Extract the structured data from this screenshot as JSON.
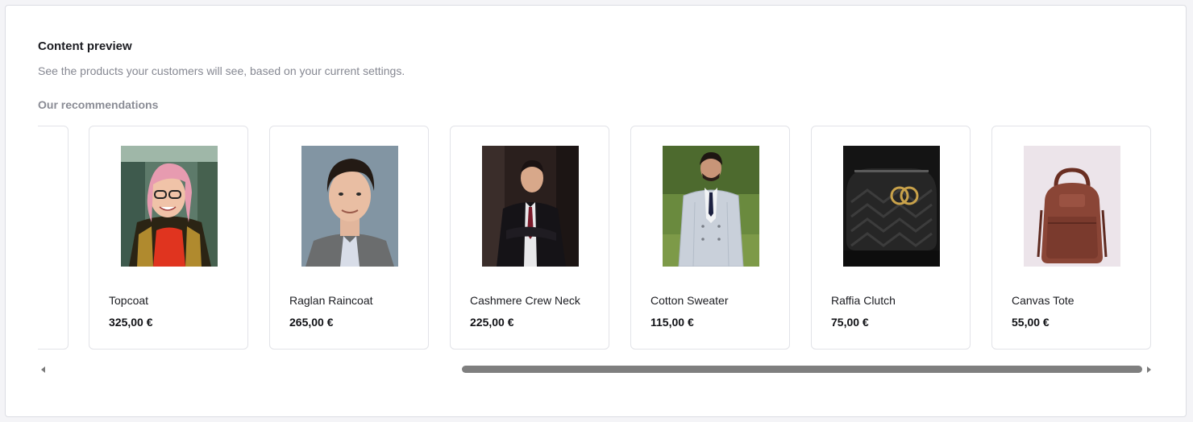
{
  "header": {
    "title": "Content preview",
    "subtitle": "See the products your customers will see, based on your current settings."
  },
  "recommendations": {
    "label": "Our recommendations",
    "products": [
      {
        "name": "Topcoat",
        "price": "325,00 €"
      },
      {
        "name": "Raglan Raincoat",
        "price": "265,00 €"
      },
      {
        "name": "Cashmere Crew Neck",
        "price": "225,00 €"
      },
      {
        "name": "Cotton Sweater",
        "price": "115,00 €"
      },
      {
        "name": "Raffia Clutch",
        "price": "75,00 €"
      },
      {
        "name": "Canvas Tote",
        "price": "55,00 €"
      }
    ]
  },
  "scrollbar": {
    "position": 0.38
  }
}
